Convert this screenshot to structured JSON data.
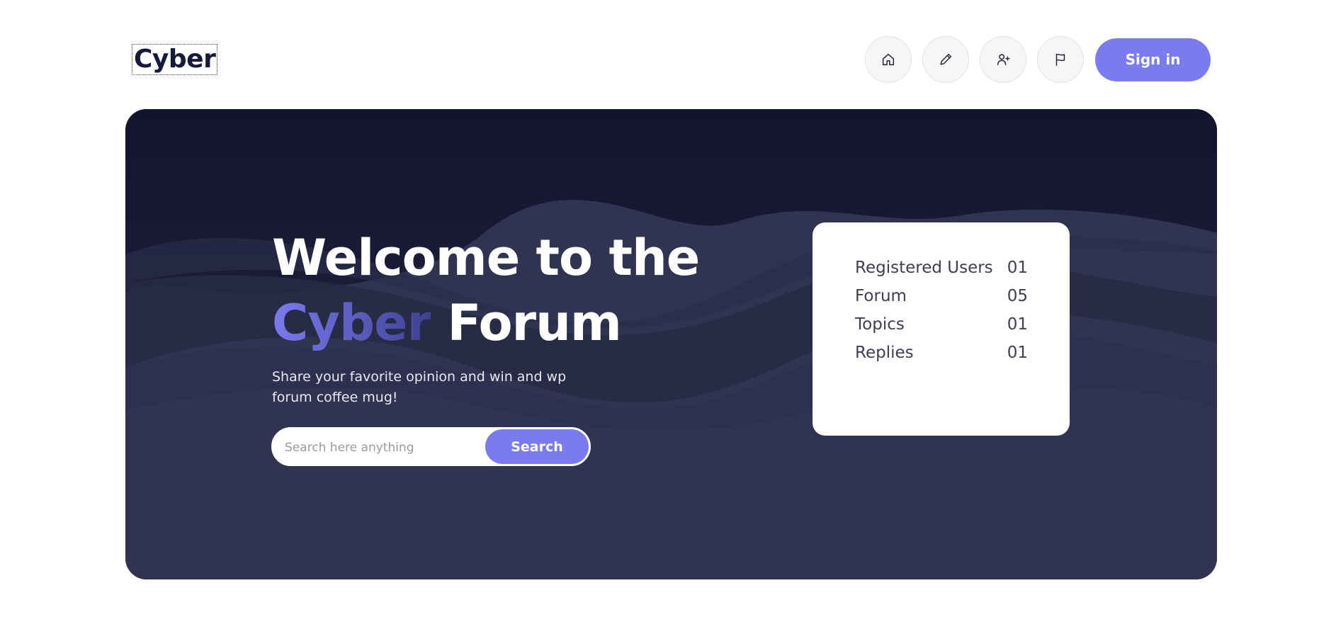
{
  "header": {
    "logo": "Cyber",
    "nav_icons": [
      "home-icon",
      "pencil-icon",
      "user-plus-icon",
      "flag-icon"
    ],
    "signin_label": "Sign in"
  },
  "hero": {
    "title_line1": "Welcome to the",
    "title_accent": "Cyber",
    "title_rest": " Forum",
    "subtitle": "Share your favorite opinion and win and wp forum coffee mug!",
    "search": {
      "placeholder": "Search here anything",
      "button_label": "Search"
    }
  },
  "stats": [
    {
      "label": "Registered Users",
      "value": "01"
    },
    {
      "label": "Forum",
      "value": "05"
    },
    {
      "label": "Topics",
      "value": "01"
    },
    {
      "label": "Replies",
      "value": "01"
    }
  ],
  "colors": {
    "accent": "#7b7bf0",
    "hero_dark": "#141631",
    "hero_light": "#303450",
    "logo_text": "#151a3a"
  }
}
